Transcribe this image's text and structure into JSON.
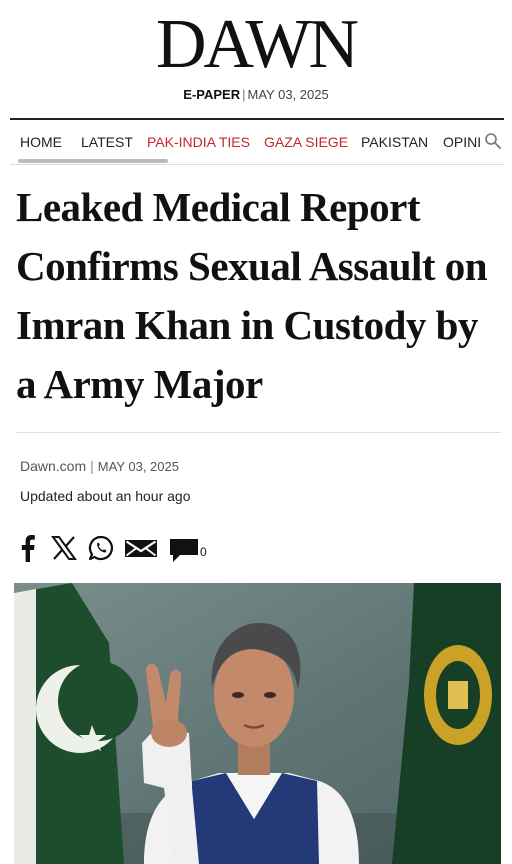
{
  "masthead": {
    "logo": "DAWN",
    "edition_label": "E-PAPER",
    "separator": "|",
    "edition_date": "MAY 03, 2025"
  },
  "nav": {
    "items": [
      {
        "label": "HOME",
        "highlight": false
      },
      {
        "label": "LATEST",
        "highlight": false
      },
      {
        "label": "PAK-INDIA TIES",
        "highlight": true
      },
      {
        "label": "GAZA SIEGE",
        "highlight": true
      },
      {
        "label": "PAKISTAN",
        "highlight": false
      },
      {
        "label": "OPINI",
        "highlight": false
      }
    ],
    "search_icon": "search-icon"
  },
  "article": {
    "headline": "Leaked Medical Report Confirms Sexual Assault on Imran Khan in Custody by a Army Major",
    "source": "Dawn.com",
    "byline_separator": "|",
    "date": "MAY 03, 2025",
    "updated": "Updated about an hour ago",
    "comment_count": "0"
  },
  "share_icons": [
    "facebook-icon",
    "x-icon",
    "whatsapp-icon",
    "email-icon",
    "comment-icon"
  ],
  "colors": {
    "accent_red": "#c62828",
    "text": "#111111",
    "muted": "#555555"
  }
}
